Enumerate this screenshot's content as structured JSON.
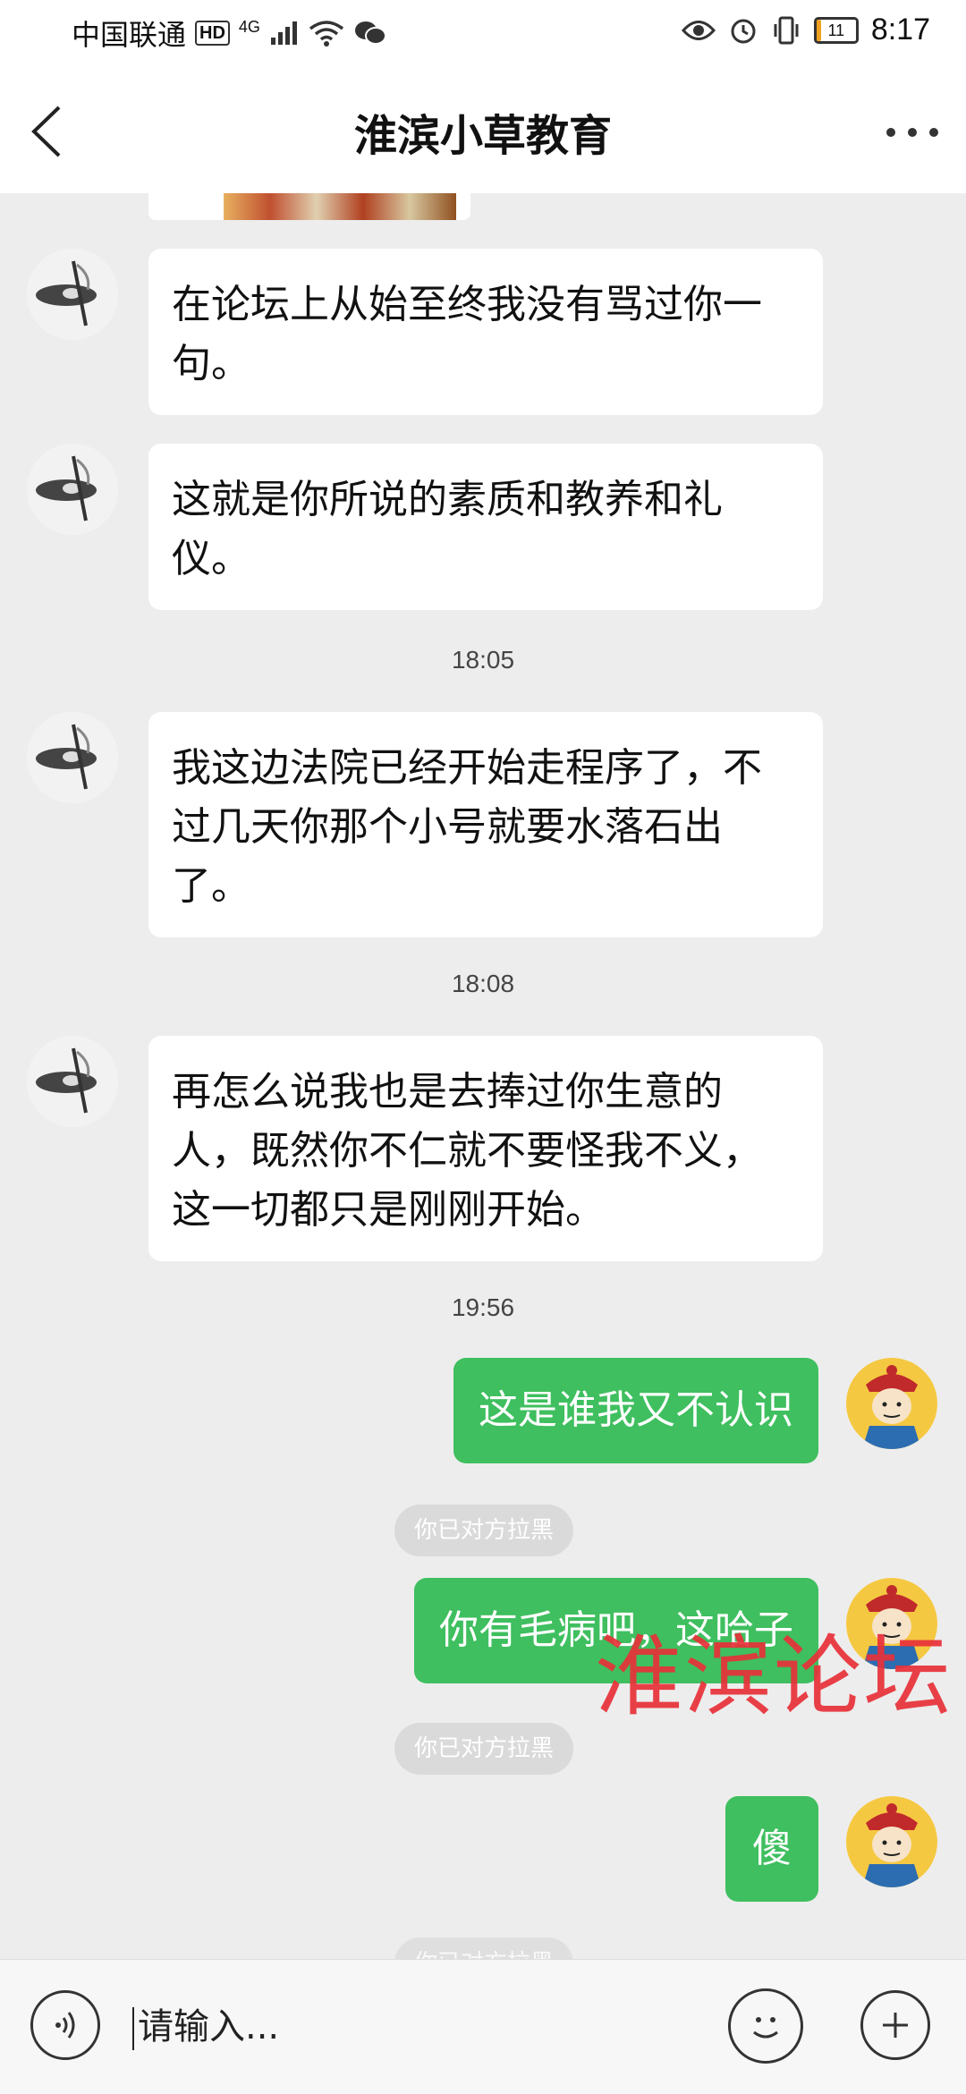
{
  "status_bar": {
    "carrier": "中国联通",
    "hd": "HD",
    "network": "4G",
    "battery": "11",
    "battery_level_percent": 11,
    "time": "8:17"
  },
  "header": {
    "title": "淮滨小草教育"
  },
  "messages": [
    {
      "id": "m1",
      "direction": "incoming",
      "text": "在论坛上从始至终我没有骂过你一句。"
    },
    {
      "id": "m2",
      "direction": "incoming",
      "text": "这就是你所说的素质和教养和礼仪。"
    },
    {
      "id": "t1",
      "type": "timestamp",
      "text": "18:05"
    },
    {
      "id": "m3",
      "direction": "incoming",
      "text": "我这边法院已经开始走程序了，不过几天你那个小号就要水落石出了。"
    },
    {
      "id": "t2",
      "type": "timestamp",
      "text": "18:08"
    },
    {
      "id": "m4",
      "direction": "incoming",
      "text": "再怎么说我也是去捧过你生意的人，既然你不仁就不要怪我不义，这一切都只是刚刚开始。"
    },
    {
      "id": "t3",
      "type": "timestamp",
      "text": "19:56"
    },
    {
      "id": "m5",
      "direction": "outgoing",
      "text": "这是谁我又不认识"
    },
    {
      "id": "s1",
      "type": "system",
      "text": "你已对方拉黑"
    },
    {
      "id": "m6",
      "direction": "outgoing",
      "text": "你有毛病吧，这哈子"
    },
    {
      "id": "s2",
      "type": "system",
      "text": "你已对方拉黑"
    },
    {
      "id": "m7",
      "direction": "outgoing",
      "text": "傻"
    },
    {
      "id": "s3",
      "type": "system",
      "text": "你已对方拉黑"
    }
  ],
  "watermark": "淮滨论坛",
  "input_bar": {
    "placeholder": "请输入..."
  },
  "icons": {
    "back": "back-chevron-icon",
    "more": "more-dots-icon",
    "voice": "voice-icon",
    "emoji": "emoji-icon",
    "plus": "plus-icon",
    "eye": "eye-icon",
    "alarm": "alarm-icon",
    "vibrate": "vibrate-icon",
    "wifi": "wifi-icon",
    "wechat": "wechat-icon"
  },
  "colors": {
    "outgoing_bubble": "#3fbf5f",
    "incoming_bubble": "#ffffff",
    "chat_background": "#ededed",
    "watermark": "#e8313a"
  }
}
